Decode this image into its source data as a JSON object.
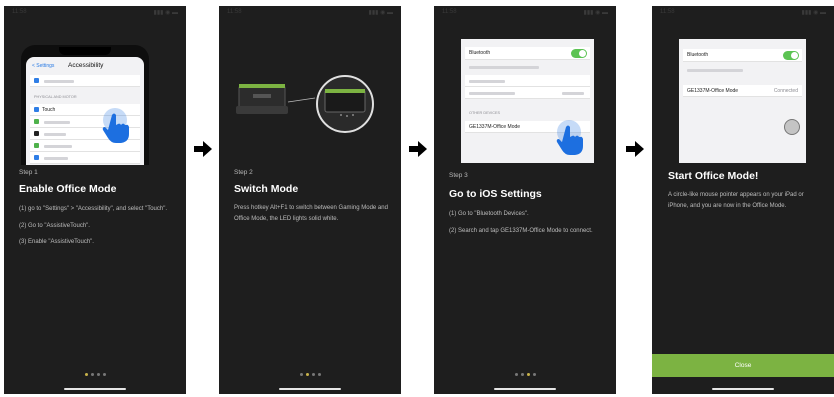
{
  "status_bar": {
    "time": "11:58",
    "signal": "▮▮▮ ◉ ▬"
  },
  "step1": {
    "label": "Step 1",
    "title": "Enable Office Mode",
    "lines": [
      "(1) go to \"Settings\" > \"Accessibility\", and select \"Touch\".",
      "(2) Go to \"AssistiveTouch\".",
      "(3) Enable \"AssistiveTouch\"."
    ],
    "screen": {
      "back": "< Settings",
      "header": "Accessibility",
      "section": "PHYSICAL AND MOTOR",
      "touch_row": "Touch"
    }
  },
  "step2": {
    "label": "Step 2",
    "title": "Switch Mode",
    "lines": [
      "Press hotkey Alt+F1 to switch between Gaming Mode and Office Mode, the LED lights solid white."
    ]
  },
  "step3": {
    "label": "Step 3",
    "title": "Go to iOS Settings",
    "lines": [
      "(1) Go to \"Bluetooth Devices\".",
      "(2) Search and tap GE1337M-Office Mode to connect."
    ],
    "screen": {
      "bluetooth": "Bluetooth",
      "section": "OTHER DEVICES",
      "device": "GE1337M-Office Mode"
    }
  },
  "step4": {
    "title": "Start Office Mode!",
    "lines": [
      "A circle-like mouse pointer appears on your iPad or iPhone, and you are now in the Office Mode."
    ],
    "screen": {
      "bluetooth": "Bluetooth",
      "device": "GE1337M-Office Mode",
      "status": "Connected"
    },
    "close_label": "Close"
  },
  "pager": {
    "total": 4
  },
  "colors": {
    "accent_green": "#7cb342",
    "toggle_green": "#5cc353",
    "active_dot": "#c8b24a",
    "panel_bg": "#1e1e1e"
  },
  "icons": [
    "hand-pointer-icon",
    "arrow-right-icon",
    "keyboard-device-icon",
    "round-pointer-icon"
  ]
}
